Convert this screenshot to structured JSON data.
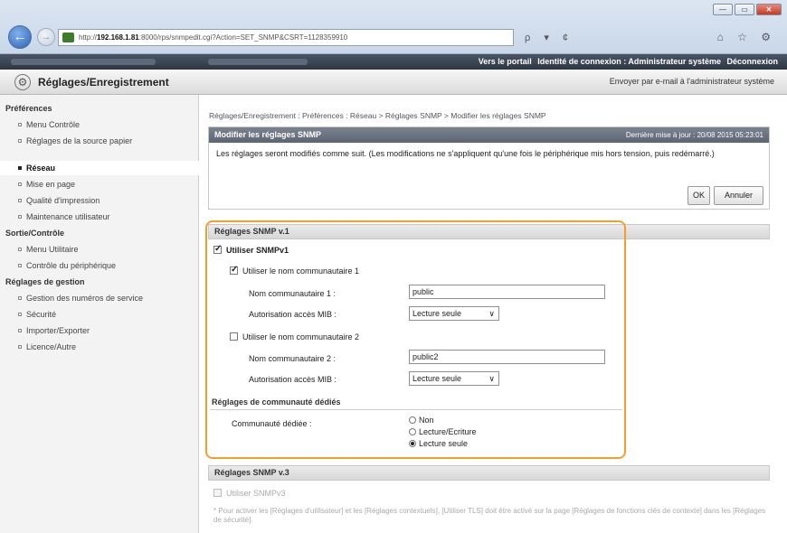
{
  "browser": {
    "url_prefix": "http://",
    "url_host": "192.168.1.81",
    "url_rest": ":8000/rps/snmpedit.cgi?Action=SET_SNMP&CSRT=1128359910",
    "search_glyph": "ρ ▾ ¢",
    "tools_glyph": "⌂ ☆ ⚙",
    "min": "—",
    "max": "▭",
    "close": "✕"
  },
  "band": {
    "portal": "Vers le portail",
    "login_id": "Identité de connexion : Administrateur système",
    "logout": "Déconnexion"
  },
  "header": {
    "title": "Réglages/Enregistrement",
    "mail_link": "Envoyer par e-mail à l'administrateur système"
  },
  "sidebar": {
    "section1": "Préférences",
    "items1": [
      "Menu Contrôle",
      "Réglages de la source papier",
      "Réseau",
      "Mise en page",
      "Qualité d'impression",
      "Maintenance utilisateur"
    ],
    "section2": "Sortie/Contrôle",
    "items2": [
      "Menu Utilitaire",
      "Contrôle du périphérique"
    ],
    "section3": "Réglages de gestion",
    "items3": [
      "Gestion des numéros de service",
      "Sécurité",
      "Importer/Exporter",
      "Licence/Autre"
    ]
  },
  "breadcrumb": "Réglages/Enregistrement : Préférences : Réseau > Réglages SNMP > Modifier les réglages SNMP",
  "edit": {
    "title": "Modifier les réglages SNMP",
    "last_update": "Dernière mise à jour : 20/08 2015 05:23:01",
    "message": "Les réglages seront modifiés comme suit. (Les modifications ne s'appliquent qu'une fois le périphérique mis hors tension, puis redémarré.)",
    "ok": "OK",
    "cancel": "Annuler"
  },
  "snmpv1": {
    "title": "Réglages SNMP v.1",
    "use_v1": "Utiliser SNMPv1",
    "use_v1_checked": true,
    "community1_label": "Utiliser le nom communautaire 1",
    "community1_checked": true,
    "name1_label": "Nom communautaire 1 :",
    "name1_value": "public",
    "mib1_label": "Autorisation accès MIB :",
    "mib1_value": "Lecture seule",
    "community2_label": "Utiliser le nom communautaire 2",
    "community2_checked": false,
    "name2_label": "Nom communautaire 2 :",
    "name2_value": "public2",
    "mib2_label": "Autorisation accès MIB :",
    "mib2_value": "Lecture seule",
    "dedicated_title": "Réglages de communauté dédiés",
    "dedicated_label": "Communauté dédiée :",
    "options": [
      "Non",
      "Lecture/Ecriture",
      "Lecture seule"
    ],
    "selected_option": "Lecture seule"
  },
  "snmpv3": {
    "title": "Réglages SNMP v.3",
    "use_v3": "Utiliser SNMPv3",
    "note": "* Pour activer les [Réglages d'utilisateur] et les [Réglages contextuels], [Utiliser TLS] doit être activé sur la page [Réglages de fonctions clés de contexte] dans les [Réglages de sécurité]."
  },
  "colors": {
    "highlight": "#f0a030",
    "section_header": "#5c6571"
  }
}
